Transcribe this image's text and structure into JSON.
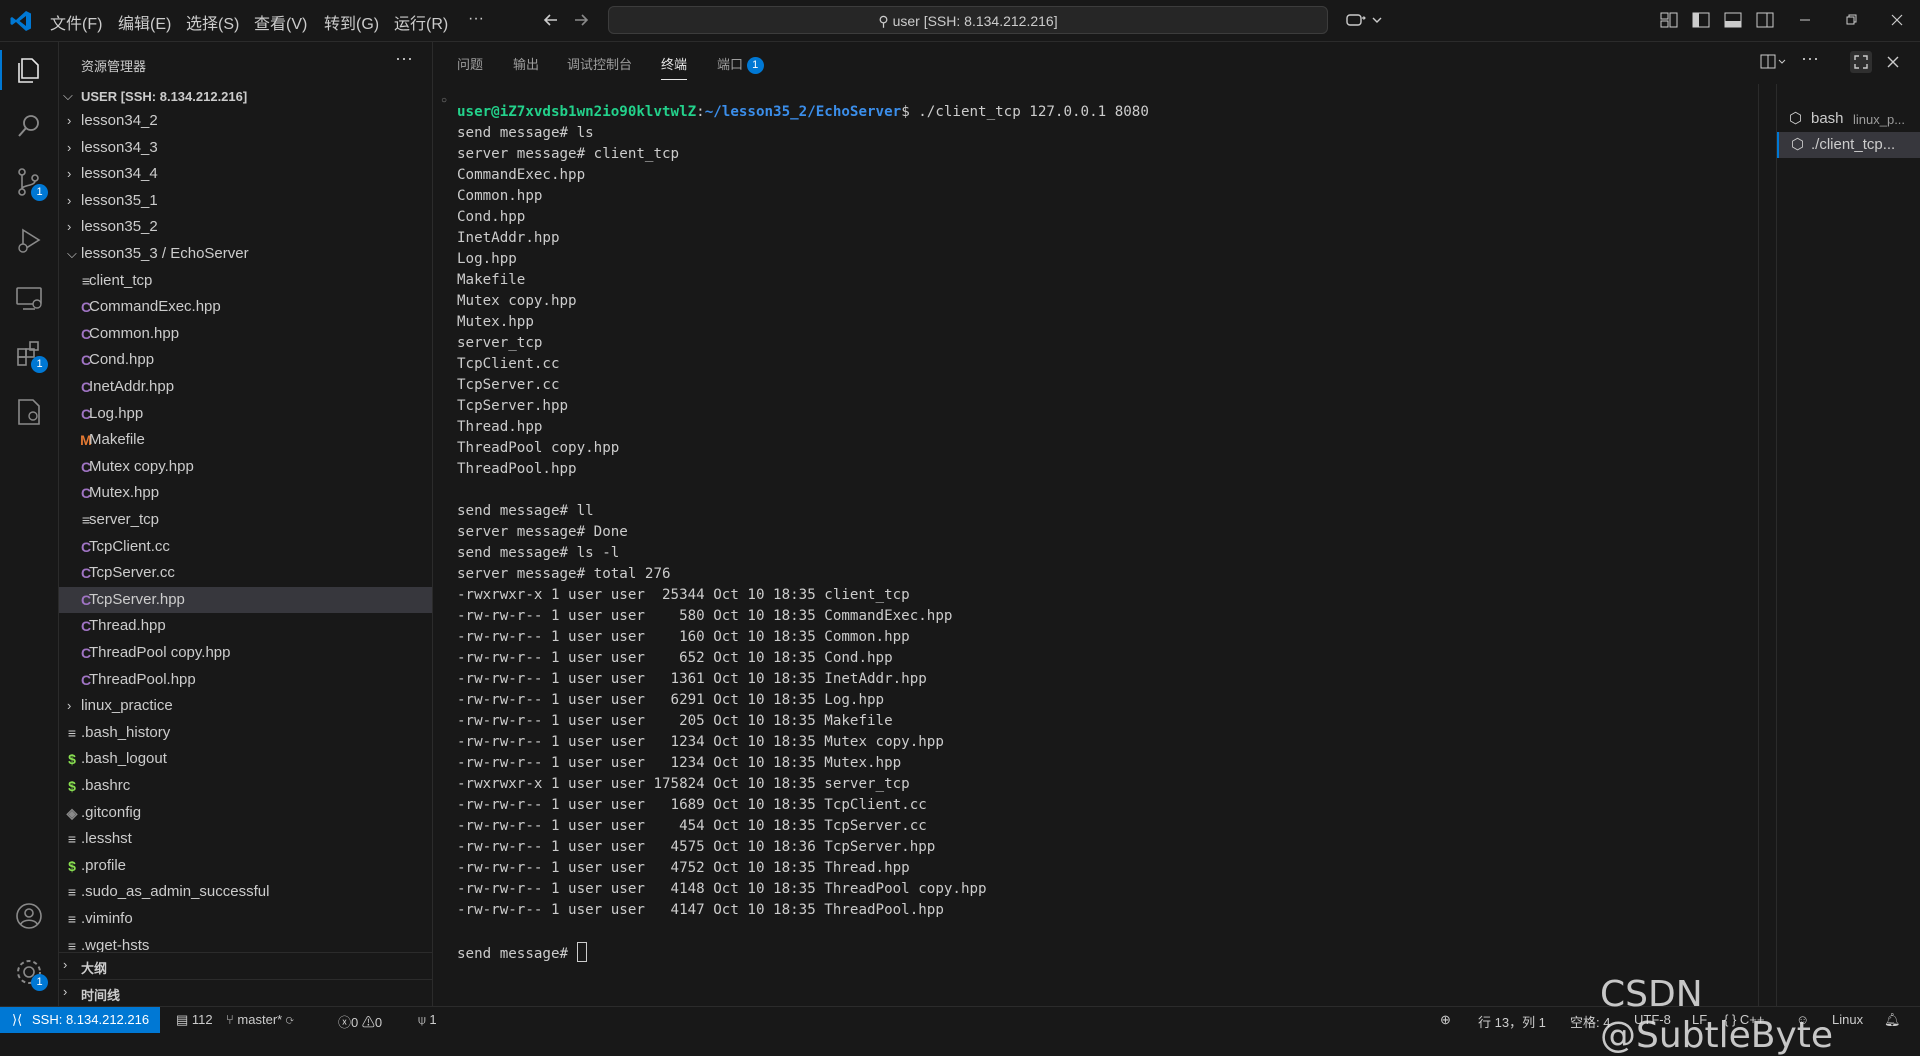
{
  "titlebar": {
    "menus": [
      "文件(F)",
      "编辑(E)",
      "选择(S)",
      "查看(V)",
      "转到(G)",
      "运行(R)",
      "···"
    ],
    "search_text": "user [SSH: 8.134.212.216]"
  },
  "activity": {
    "scm_badge": "1",
    "extensions_badge": "1",
    "settings_badge": "1"
  },
  "sidebar": {
    "title": "资源管理器",
    "more": "···",
    "root": "USER [SSH: 8.134.212.216]",
    "items": [
      {
        "label": "lesson34_2",
        "kind": "folder",
        "level": 1,
        "open": false
      },
      {
        "label": "lesson34_3",
        "kind": "folder",
        "level": 1,
        "open": false
      },
      {
        "label": "lesson34_4",
        "kind": "folder",
        "level": 1,
        "open": false
      },
      {
        "label": "lesson35_1",
        "kind": "folder",
        "level": 1,
        "open": false
      },
      {
        "label": "lesson35_2",
        "kind": "folder",
        "level": 1,
        "open": false
      },
      {
        "label": "lesson35_3 / EchoServer",
        "kind": "folder",
        "level": 1,
        "open": true
      },
      {
        "label": "client_tcp",
        "kind": "text",
        "level": 2
      },
      {
        "label": "CommandExec.hpp",
        "kind": "cpp",
        "level": 2
      },
      {
        "label": "Common.hpp",
        "kind": "cpp",
        "level": 2
      },
      {
        "label": "Cond.hpp",
        "kind": "cpp",
        "level": 2
      },
      {
        "label": "InetAddr.hpp",
        "kind": "cpp",
        "level": 2
      },
      {
        "label": "Log.hpp",
        "kind": "cpp",
        "level": 2
      },
      {
        "label": "Makefile",
        "kind": "make",
        "level": 2
      },
      {
        "label": "Mutex copy.hpp",
        "kind": "cpp",
        "level": 2
      },
      {
        "label": "Mutex.hpp",
        "kind": "cpp",
        "level": 2
      },
      {
        "label": "server_tcp",
        "kind": "text",
        "level": 2
      },
      {
        "label": "TcpClient.cc",
        "kind": "cc",
        "level": 2
      },
      {
        "label": "TcpServer.cc",
        "kind": "cc",
        "level": 2
      },
      {
        "label": "TcpServer.hpp",
        "kind": "cpp",
        "level": 2,
        "selected": true
      },
      {
        "label": "Thread.hpp",
        "kind": "cpp",
        "level": 2
      },
      {
        "label": "ThreadPool copy.hpp",
        "kind": "cpp",
        "level": 2
      },
      {
        "label": "ThreadPool.hpp",
        "kind": "cpp",
        "level": 2
      },
      {
        "label": "linux_practice",
        "kind": "folder",
        "level": 1,
        "open": false
      },
      {
        "label": ".bash_history",
        "kind": "text",
        "level": 1
      },
      {
        "label": ".bash_logout",
        "kind": "shell",
        "level": 1
      },
      {
        "label": ".bashrc",
        "kind": "shell",
        "level": 1
      },
      {
        "label": ".gitconfig",
        "kind": "git",
        "level": 1
      },
      {
        "label": ".lesshst",
        "kind": "text",
        "level": 1
      },
      {
        "label": ".profile",
        "kind": "shell",
        "level": 1
      },
      {
        "label": ".sudo_as_admin_successful",
        "kind": "text",
        "level": 1
      },
      {
        "label": ".viminfo",
        "kind": "text",
        "level": 1
      },
      {
        "label": ".wget-hsts",
        "kind": "text",
        "level": 1
      }
    ],
    "outline": "大纲",
    "timeline": "时间线"
  },
  "panel": {
    "tabs": [
      "问题",
      "输出",
      "调试控制台",
      "终端",
      "端口"
    ],
    "active_tab": "终端",
    "ports_badge": "1",
    "terminals": [
      "bash",
      "linux_p...",
      "./client_tcp..."
    ]
  },
  "terminal": {
    "prompt_user": "user@iZ7xvdsb1wn2io90klvtwlZ",
    "prompt_sep": ":",
    "prompt_path": "~/lesson35_2/EchoServer",
    "prompt_cmd": "$ ./client_tcp 127.0.0.1 8080",
    "lines": [
      "send message# ls",
      "server message# client_tcp",
      "CommandExec.hpp",
      "Common.hpp",
      "Cond.hpp",
      "InetAddr.hpp",
      "Log.hpp",
      "Makefile",
      "Mutex copy.hpp",
      "Mutex.hpp",
      "server_tcp",
      "TcpClient.cc",
      "TcpServer.cc",
      "TcpServer.hpp",
      "Thread.hpp",
      "ThreadPool copy.hpp",
      "ThreadPool.hpp",
      "",
      "send message# ll",
      "server message# Done",
      "send message# ls -l",
      "server message# total 276",
      "-rwxrwxr-x 1 user user  25344 Oct 10 18:35 client_tcp",
      "-rw-rw-r-- 1 user user    580 Oct 10 18:35 CommandExec.hpp",
      "-rw-rw-r-- 1 user user    160 Oct 10 18:35 Common.hpp",
      "-rw-rw-r-- 1 user user    652 Oct 10 18:35 Cond.hpp",
      "-rw-rw-r-- 1 user user   1361 Oct 10 18:35 InetAddr.hpp",
      "-rw-rw-r-- 1 user user   6291 Oct 10 18:35 Log.hpp",
      "-rw-rw-r-- 1 user user    205 Oct 10 18:35 Makefile",
      "-rw-rw-r-- 1 user user   1234 Oct 10 18:35 Mutex copy.hpp",
      "-rw-rw-r-- 1 user user   1234 Oct 10 18:35 Mutex.hpp",
      "-rwxrwxr-x 1 user user 175824 Oct 10 18:35 server_tcp",
      "-rw-rw-r-- 1 user user   1689 Oct 10 18:35 TcpClient.cc",
      "-rw-rw-r-- 1 user user    454 Oct 10 18:35 TcpServer.cc",
      "-rw-rw-r-- 1 user user   4575 Oct 10 18:36 TcpServer.hpp",
      "-rw-rw-r-- 1 user user   4752 Oct 10 18:35 Thread.hpp",
      "-rw-rw-r-- 1 user user   4148 Oct 10 18:35 ThreadPool copy.hpp",
      "-rw-rw-r-- 1 user user   4147 Oct 10 18:35 ThreadPool.hpp",
      ""
    ],
    "input_prompt": "send message# "
  },
  "statusbar": {
    "remote": "SSH: 8.134.212.216",
    "terminals_count": "112",
    "branch": "master*",
    "errors": "0",
    "warnings": "0",
    "ports": "1",
    "position": "行 13，列 1",
    "spaces": "空格: 4",
    "encoding": "UTF-8",
    "eol": "LF",
    "language": "{ } C++",
    "platform": "Linux"
  },
  "watermark": "CSDN @SubtleByte",
  "colors": {
    "accent": "#0078d4",
    "cpp_icon": "#a074c4",
    "makefile_icon": "#e37933",
    "shell_icon": "#89e051",
    "prompt_user": "#23d18b",
    "prompt_path": "#3b8eea"
  }
}
